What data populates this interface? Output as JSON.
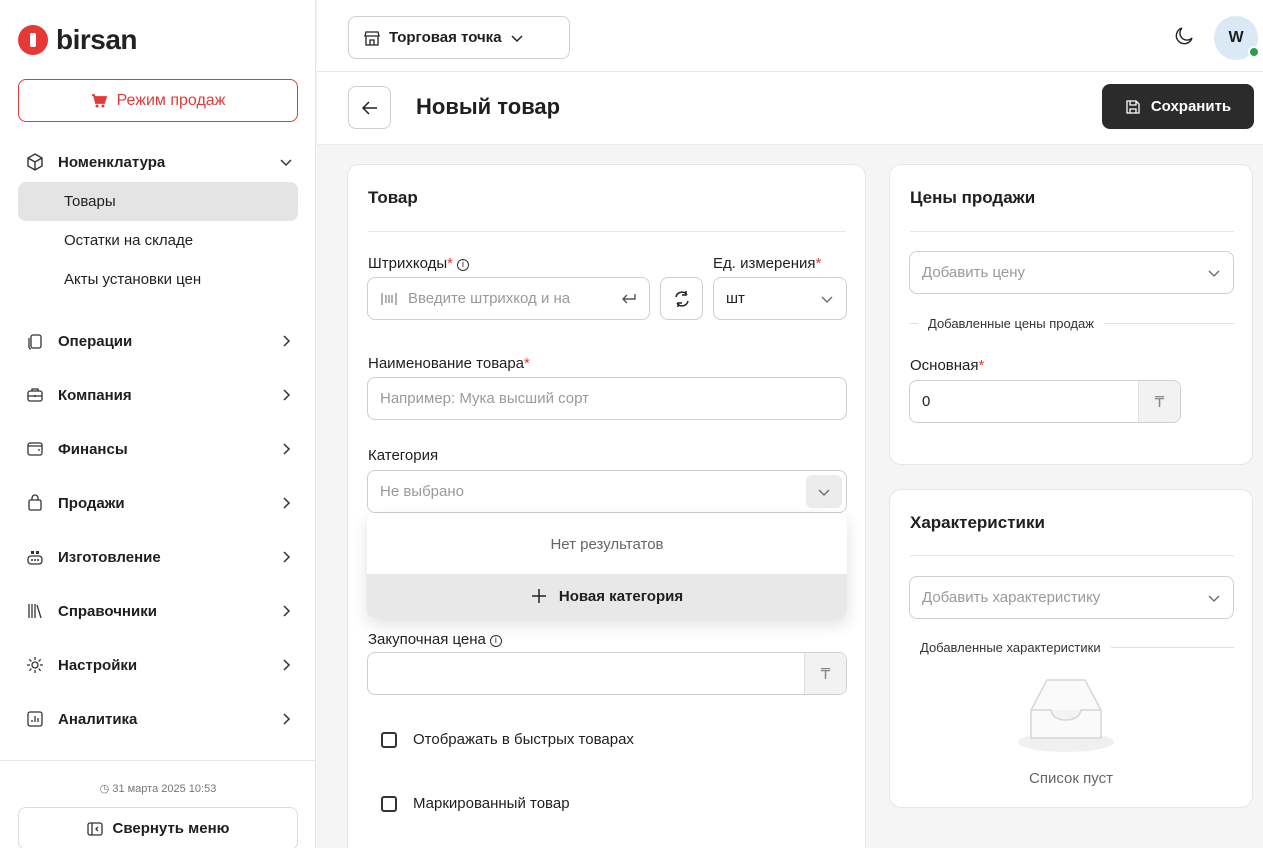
{
  "brand": {
    "name": "birsan",
    "accent": "#e53935"
  },
  "sidebar": {
    "sales_mode": "Режим продаж",
    "nomenclature": {
      "label": "Номенклатура",
      "items": [
        "Товары",
        "Остатки на складе",
        "Акты установки цен"
      ]
    },
    "items": [
      {
        "label": "Операции",
        "icon": "operations-icon"
      },
      {
        "label": "Компания",
        "icon": "briefcase-icon"
      },
      {
        "label": "Финансы",
        "icon": "wallet-icon"
      },
      {
        "label": "Продажи",
        "icon": "bag-icon"
      },
      {
        "label": "Изготовление",
        "icon": "production-icon"
      },
      {
        "label": "Справочники",
        "icon": "books-icon"
      },
      {
        "label": "Настройки",
        "icon": "gear-icon"
      },
      {
        "label": "Аналитика",
        "icon": "chart-icon"
      }
    ],
    "datetime": "31 марта 2025 10:53",
    "collapse": "Свернуть меню"
  },
  "topbar": {
    "store": "Торговая точка",
    "avatar": "W"
  },
  "page": {
    "title": "Новый товар",
    "save": "Сохранить"
  },
  "product_card": {
    "title": "Товар",
    "barcodes_label": "Штрихкоды",
    "barcode_placeholder": "Введите штрихкод и на",
    "unit_label": "Ед. измерения",
    "unit_value": "шт",
    "name_label": "Наименование товара",
    "name_placeholder": "Например: Мука высший сорт",
    "category_label": "Категория",
    "category_placeholder": "Не выбрано",
    "dropdown_empty": "Нет результатов",
    "dropdown_new": "Новая категория",
    "purchase_label": "Закупочная цена",
    "currency": "₸",
    "quick_products": "Отображать в быстрых товарах",
    "marked_product": "Маркированный товар"
  },
  "prices_card": {
    "title": "Цены продажи",
    "add_placeholder": "Добавить цену",
    "added_label": "Добавленные цены продаж",
    "main_label": "Основная",
    "main_value": "0",
    "currency": "₸"
  },
  "specs_card": {
    "title": "Характеристики",
    "add_placeholder": "Добавить характеристику",
    "added_label": "Добавленные характеристики",
    "empty": "Список пуст"
  }
}
